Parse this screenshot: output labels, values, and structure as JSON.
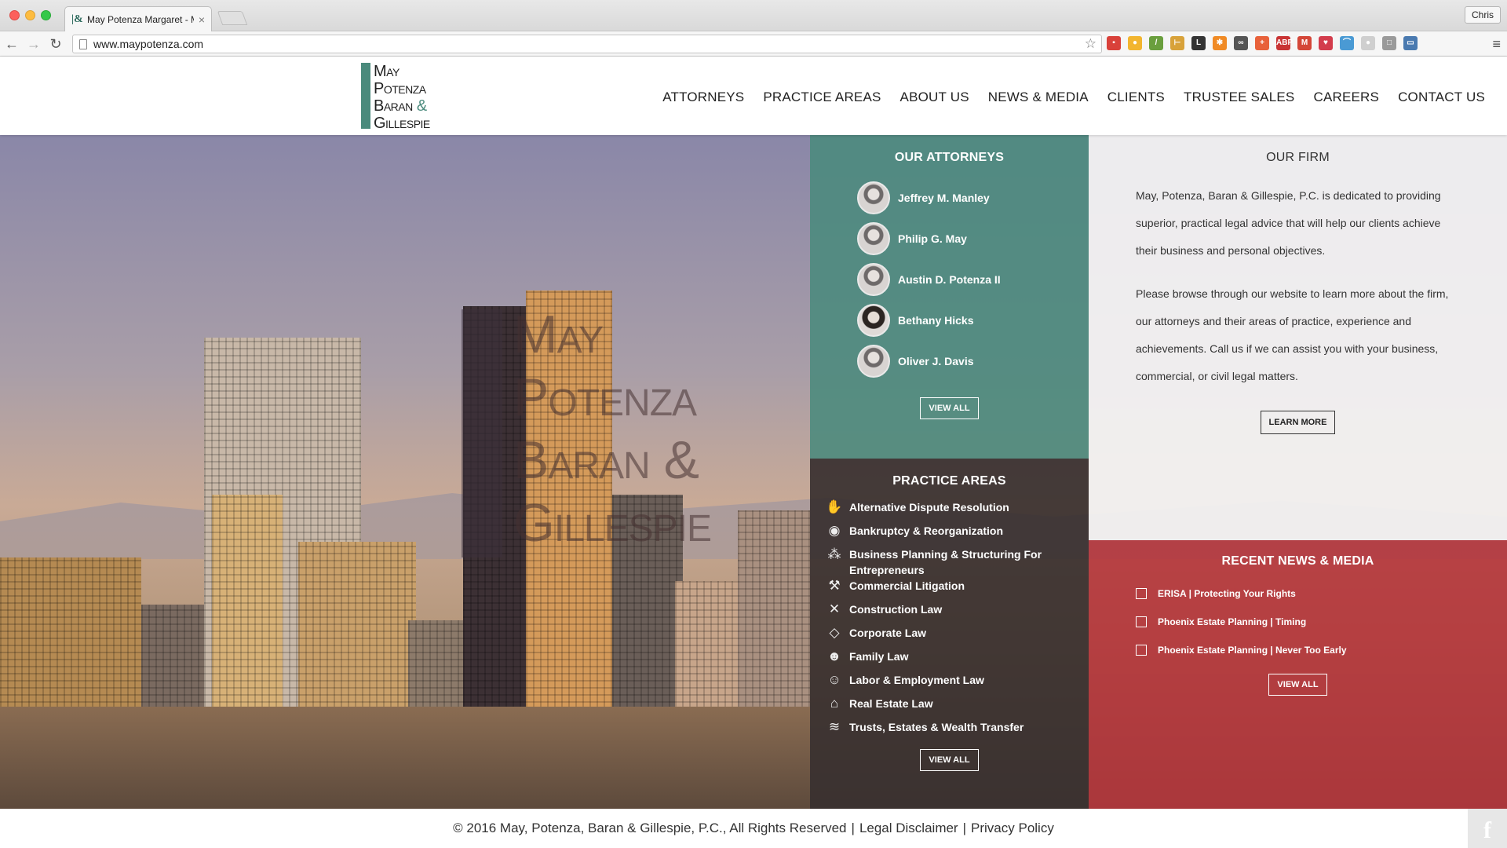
{
  "browser": {
    "tab_title": "May Potenza Margaret - M",
    "tab_close": "×",
    "profile_name": "Chris",
    "url": "www.maypotenza.com",
    "back": "←",
    "forward": "→",
    "reload": "↻",
    "star": "☆",
    "menu": "≡",
    "extensions": [
      {
        "name": "ext-red-icon",
        "color": "#d9413a",
        "label": "▪"
      },
      {
        "name": "ext-yellow-icon",
        "color": "#f2b52f",
        "label": "●"
      },
      {
        "name": "ext-eyedropper-icon",
        "color": "#6a9f3e",
        "label": "/"
      },
      {
        "name": "ext-signpost-icon",
        "color": "#d8a23a",
        "label": "⊢"
      },
      {
        "name": "ext-l-icon",
        "color": "#333333",
        "label": "L"
      },
      {
        "name": "ext-orange-icon",
        "color": "#f08a24",
        "label": "✱"
      },
      {
        "name": "ext-glasses-icon",
        "color": "#555555",
        "label": "∞"
      },
      {
        "name": "ext-plus-icon",
        "color": "#e8613a",
        "label": "+"
      },
      {
        "name": "ext-abp-icon",
        "color": "#c93434",
        "label": "ABP"
      },
      {
        "name": "ext-gmail-icon",
        "color": "#d44638",
        "label": "M"
      },
      {
        "name": "ext-pocket-icon",
        "color": "#d33c4c",
        "label": "♥"
      },
      {
        "name": "ext-rainbow-icon",
        "color": "#4a9ad4",
        "label": "⌒"
      },
      {
        "name": "ext-grey-circle-icon",
        "color": "#cfcfcf",
        "label": "●"
      },
      {
        "name": "ext-grey-square-icon",
        "color": "#9a9a9a",
        "label": "□"
      },
      {
        "name": "ext-screen-icon",
        "color": "#4a7ab0",
        "label": "▭"
      }
    ]
  },
  "site": {
    "logo": {
      "line1": "May",
      "line2": "Potenza",
      "line3": "Baran",
      "amp": "&",
      "line4": "Gillespie"
    },
    "nav": [
      "ATTORNEYS",
      "PRACTICE AREAS",
      "ABOUT US",
      "NEWS & MEDIA",
      "CLIENTS",
      "TRUSTEE SALES",
      "CAREERS",
      "CONTACT US"
    ],
    "hero_logo": {
      "line1": "May",
      "line2": "Potenza",
      "line3": "Baran &",
      "line4": "Gillespie"
    }
  },
  "attorneys": {
    "title": "OUR ATTORNEYS",
    "items": [
      "Jeffrey M. Manley",
      "Philip G. May",
      "Austin D. Potenza II",
      "Bethany Hicks",
      "Oliver J. Davis"
    ],
    "view_all": "VIEW ALL"
  },
  "practice": {
    "title": "PRACTICE AREAS",
    "items": [
      {
        "label": "Alternative Dispute Resolution",
        "icon": "handshake-icon",
        "glyph": "✋"
      },
      {
        "label": "Bankruptcy & Reorganization",
        "icon": "money-bag-icon",
        "glyph": "◉"
      },
      {
        "label": "Business Planning & Structuring For Entrepreneurs",
        "icon": "network-icon",
        "glyph": "⁂"
      },
      {
        "label": "Commercial Litigation",
        "icon": "gavel-icon",
        "glyph": "⚒"
      },
      {
        "label": "Construction Law",
        "icon": "tools-icon",
        "glyph": "✕"
      },
      {
        "label": "Corporate Law",
        "icon": "diamond-icon",
        "glyph": "◇"
      },
      {
        "label": "Family Law",
        "icon": "family-icon",
        "glyph": "☻"
      },
      {
        "label": "Labor & Employment Law",
        "icon": "worker-icon",
        "glyph": "☺"
      },
      {
        "label": "Real Estate Law",
        "icon": "house-icon",
        "glyph": "⌂"
      },
      {
        "label": "Trusts, Estates & Wealth Transfer",
        "icon": "money-stack-icon",
        "glyph": "≋"
      }
    ],
    "view_all": "VIEW ALL"
  },
  "firm": {
    "title": "OUR FIRM",
    "p1": "May, Potenza, Baran & Gillespie, P.C. is dedicated to providing superior, practical legal advice that will help our clients achieve their business and personal objectives.",
    "p2": "Please browse through our website to learn more about the firm, our attorneys and their areas of practice, experience and achievements. Call us if we can assist you with your business, commercial, or civil legal matters.",
    "learn_more": "LEARN MORE"
  },
  "news": {
    "title": "RECENT NEWS & MEDIA",
    "items": [
      "ERISA | Protecting Your Rights",
      "Phoenix Estate Planning | Timing",
      "Phoenix Estate Planning | Never Too Early"
    ],
    "view_all": "VIEW ALL"
  },
  "footer": {
    "copyright": "© 2016 May, Potenza, Baran & Gillespie, P.C., All Rights Reserved",
    "sep": "|",
    "disclaimer": "Legal Disclaimer",
    "privacy": "Privacy Policy",
    "facebook": "f"
  }
}
